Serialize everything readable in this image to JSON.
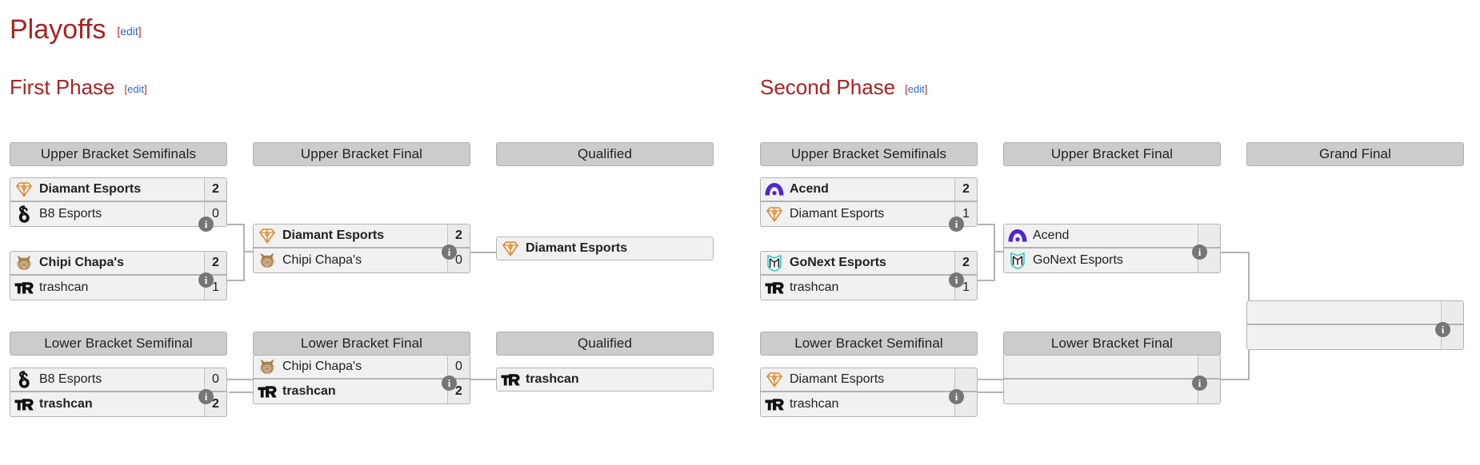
{
  "page": {
    "title": "Playoffs",
    "edit_label": "edit",
    "bracket_left": "[",
    "bracket_right": "]"
  },
  "phases": [
    {
      "name": "First Phase",
      "edit_label": "edit"
    },
    {
      "name": "Second Phase",
      "edit_label": "edit"
    }
  ],
  "round_headers": {
    "p1_ubsf": "Upper Bracket Semifinals",
    "p1_ubf": "Upper Bracket Final",
    "p1_qual_top": "Qualified",
    "p1_lbsf": "Lower Bracket Semifinal",
    "p1_lbf": "Lower Bracket Final",
    "p1_qual_bottom": "Qualified",
    "p2_ubsf": "Upper Bracket Semifinals",
    "p2_ubf": "Upper Bracket Final",
    "p2_gf": "Grand Final",
    "p2_lbsf": "Lower Bracket Semifinal",
    "p2_lbf": "Lower Bracket Final"
  },
  "info_icon": "i",
  "teams": {
    "diamant": {
      "name": "Diamant Esports",
      "logo": "diamant-logo",
      "color": "#e08a33"
    },
    "b8": {
      "name": "B8 Esports",
      "logo": "b8-logo",
      "color": "#111111"
    },
    "chipi": {
      "name": "Chipi Chapa's",
      "logo": "chipi-logo",
      "color": "#a6814c"
    },
    "trashcan": {
      "name": "trashcan",
      "logo": "trashcan-logo",
      "color": "#111111"
    },
    "acend": {
      "name": "Acend",
      "logo": "acend-logo",
      "color": "#5227cc"
    },
    "gonext": {
      "name": "GoNext Esports",
      "logo": "gonext-logo",
      "color": "#2ec6c6"
    },
    "tbd": {
      "name": "",
      "logo": "none",
      "color": "#999999"
    }
  },
  "matches": {
    "p1_ubsf_1": {
      "top": {
        "team": "diamant",
        "score": "2",
        "winner": true
      },
      "bottom": {
        "team": "b8",
        "score": "0",
        "winner": false
      }
    },
    "p1_ubsf_2": {
      "top": {
        "team": "chipi",
        "score": "2",
        "winner": true
      },
      "bottom": {
        "team": "trashcan",
        "score": "1",
        "winner": false
      }
    },
    "p1_ubf": {
      "top": {
        "team": "diamant",
        "score": "2",
        "winner": true
      },
      "bottom": {
        "team": "chipi",
        "score": "0",
        "winner": false
      }
    },
    "p1_qual_top": {
      "top": {
        "team": "diamant",
        "score": "",
        "winner": true
      }
    },
    "p1_lbsf": {
      "top": {
        "team": "b8",
        "score": "0",
        "winner": false
      },
      "bottom": {
        "team": "trashcan",
        "score": "2",
        "winner": true
      }
    },
    "p1_lbf": {
      "top": {
        "team": "chipi",
        "score": "0",
        "winner": false
      },
      "bottom": {
        "team": "trashcan",
        "score": "2",
        "winner": true
      }
    },
    "p1_qual_bottom": {
      "top": {
        "team": "trashcan",
        "score": "",
        "winner": true
      }
    },
    "p2_ubsf_1": {
      "top": {
        "team": "acend",
        "score": "2",
        "winner": true
      },
      "bottom": {
        "team": "diamant",
        "score": "1",
        "winner": false
      }
    },
    "p2_ubsf_2": {
      "top": {
        "team": "gonext",
        "score": "2",
        "winner": true
      },
      "bottom": {
        "team": "trashcan",
        "score": "1",
        "winner": false
      }
    },
    "p2_ubf": {
      "top": {
        "team": "acend",
        "score": "",
        "winner": false
      },
      "bottom": {
        "team": "gonext",
        "score": "",
        "winner": false
      }
    },
    "p2_gf": {
      "top": {
        "team": "tbd",
        "score": "",
        "winner": false
      },
      "bottom": {
        "team": "tbd",
        "score": "",
        "winner": false
      }
    },
    "p2_lbsf": {
      "top": {
        "team": "diamant",
        "score": "",
        "winner": false
      },
      "bottom": {
        "team": "trashcan",
        "score": "",
        "winner": false
      }
    },
    "p2_lbf": {
      "top": {
        "team": "tbd",
        "score": "",
        "winner": false
      },
      "bottom": {
        "team": "tbd",
        "score": "",
        "winner": false
      }
    }
  }
}
